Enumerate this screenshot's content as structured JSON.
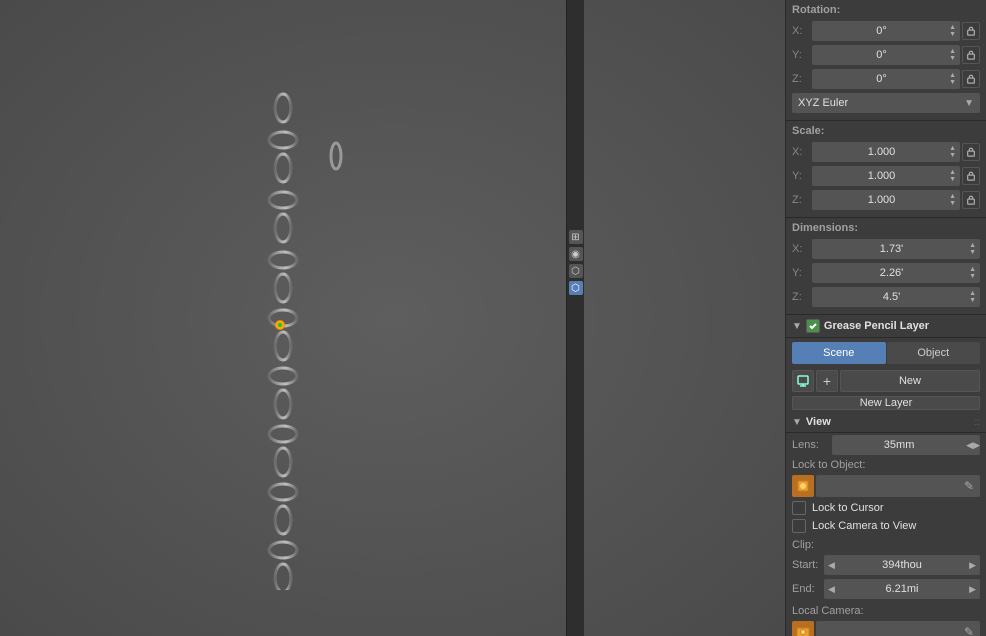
{
  "viewport": {
    "background_color": "#525252"
  },
  "properties": {
    "rotation": {
      "label": "Rotation:",
      "x": {
        "label": "X:",
        "value": "0°"
      },
      "y": {
        "label": "Y:",
        "value": "0°"
      },
      "z": {
        "label": "Z:",
        "value": "0°"
      }
    },
    "rotation_mode": {
      "value": "XYZ Euler"
    },
    "scale": {
      "label": "Scale:",
      "x": {
        "label": "X:",
        "value": "1.000"
      },
      "y": {
        "label": "Y:",
        "value": "1.000"
      },
      "z": {
        "label": "Z:",
        "value": "1.000"
      }
    },
    "dimensions": {
      "label": "Dimensions:",
      "x": {
        "label": "X:",
        "value": "1.73'"
      },
      "y": {
        "label": "Y:",
        "value": "2.26'"
      },
      "z": {
        "label": "Z:",
        "value": "4.5'"
      }
    },
    "grease_pencil_layer": {
      "label": "Grease Pencil Layer",
      "checkbox_checked": true
    },
    "scene_object_tabs": {
      "scene": "Scene",
      "object": "Object",
      "active": "scene"
    },
    "new_row": {
      "new_label": "New"
    },
    "new_layer": {
      "label": "New Layer"
    },
    "view": {
      "label": "View",
      "lens_label": "Lens:",
      "lens_value": "35mm",
      "lock_to_object_label": "Lock to Object:",
      "lock_to_cursor_label": "Lock to Cursor",
      "lock_camera_to_view_label": "Lock Camera to View",
      "clip_label": "Clip:",
      "start_label": "Start:",
      "start_value": "394thou",
      "end_label": "End:",
      "end_value": "6.21mi",
      "local_camera_label": "Local Camera:"
    }
  }
}
